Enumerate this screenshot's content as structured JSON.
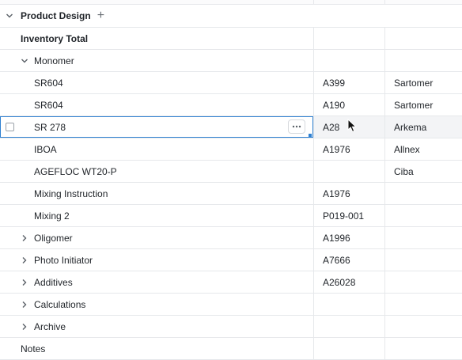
{
  "group": {
    "title": "Product Design",
    "add_icon": "plus-icon",
    "toggle_icon": "chevron-down-icon"
  },
  "rows": [
    {
      "label": "Inventory Total",
      "col2": "",
      "col3": "",
      "bold": true,
      "indent": 26,
      "toggle": "none"
    },
    {
      "label": "Monomer",
      "col2": "",
      "col3": "",
      "bold": false,
      "indent": 43,
      "toggle": "expanded"
    },
    {
      "label": "SR604",
      "col2": "A399",
      "col3": "Sartomer",
      "bold": false,
      "indent": 43,
      "toggle": "none"
    },
    {
      "label": "SR604",
      "col2": "A190",
      "col3": "Sartomer",
      "bold": false,
      "indent": 43,
      "toggle": "none"
    },
    {
      "label": "SR 278",
      "col2": "A28",
      "col3": "Arkema",
      "bold": false,
      "indent": 43,
      "toggle": "none",
      "selected": true
    },
    {
      "label": "IBOA",
      "col2": "A1976",
      "col3": "Allnex",
      "bold": false,
      "indent": 43,
      "toggle": "none"
    },
    {
      "label": "AGEFLOC WT20-P",
      "col2": "",
      "col3": "Ciba",
      "bold": false,
      "indent": 43,
      "toggle": "none"
    },
    {
      "label": "Mixing Instruction",
      "col2": "A1976",
      "col3": "",
      "bold": false,
      "indent": 43,
      "toggle": "none"
    },
    {
      "label": "Mixing 2",
      "col2": "P019-001",
      "col3": "",
      "bold": false,
      "indent": 43,
      "toggle": "none"
    },
    {
      "label": "Oligomer",
      "col2": "A1996",
      "col3": "",
      "bold": false,
      "indent": 43,
      "toggle": "collapsed"
    },
    {
      "label": "Photo Initiator",
      "col2": "A7666",
      "col3": "",
      "bold": false,
      "indent": 43,
      "toggle": "collapsed"
    },
    {
      "label": "Additives",
      "col2": "A26028",
      "col3": "",
      "bold": false,
      "indent": 43,
      "toggle": "collapsed"
    },
    {
      "label": "Calculations",
      "col2": "",
      "col3": "",
      "bold": false,
      "indent": 43,
      "toggle": "collapsed"
    },
    {
      "label": "Archive",
      "col2": "",
      "col3": "",
      "bold": false,
      "indent": 43,
      "toggle": "collapsed"
    },
    {
      "label": "Notes",
      "col2": "",
      "col3": "",
      "bold": false,
      "indent": 26,
      "toggle": "none"
    }
  ],
  "row_actions": {
    "icon": "ellipsis-icon"
  },
  "colors": {
    "accent": "#2f80d1",
    "border": "#e6e8eb",
    "selected_row": "#f3f4f6"
  }
}
